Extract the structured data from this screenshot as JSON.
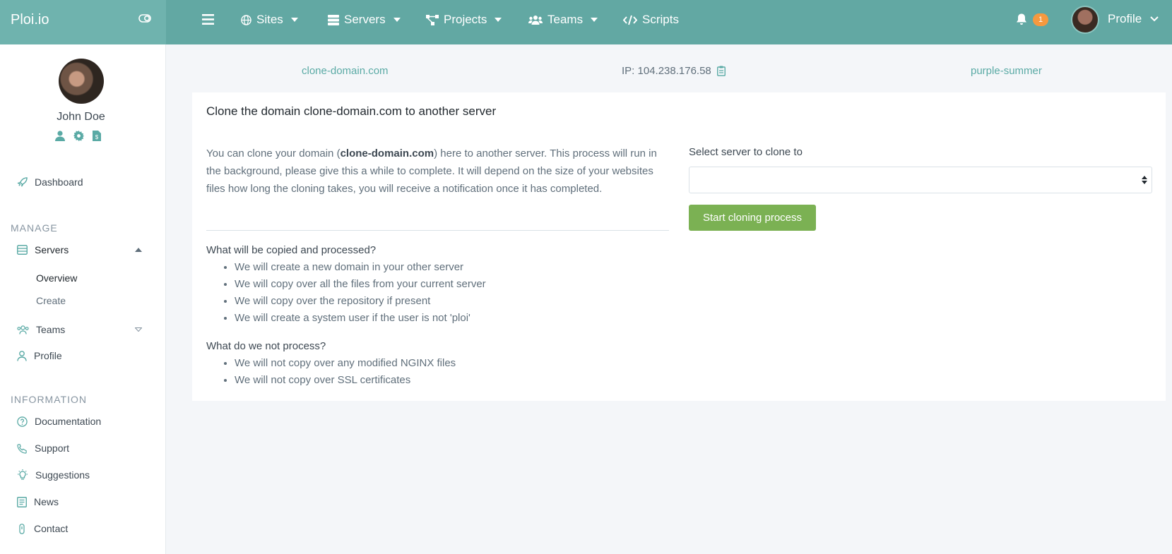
{
  "brand": {
    "name": "Ploi.io"
  },
  "nav": {
    "items": [
      {
        "label": "Sites"
      },
      {
        "label": "Servers"
      },
      {
        "label": "Projects"
      },
      {
        "label": "Teams"
      },
      {
        "label": "Scripts"
      }
    ],
    "notifications_count": "1",
    "profile_label": "Profile"
  },
  "user": {
    "name": "John Doe"
  },
  "sidebar": {
    "dashboard": "Dashboard",
    "manage_heading": "MANAGE",
    "servers": "Servers",
    "servers_sub": [
      "Overview",
      "Create"
    ],
    "teams": "Teams",
    "profile": "Profile",
    "information_heading": "INFORMATION",
    "info_links": [
      "Documentation",
      "Support",
      "Suggestions",
      "News",
      "Contact"
    ]
  },
  "info_bar": {
    "domain": "clone-domain.com",
    "ip": "IP: 104.238.176.58",
    "server": "purple-summer"
  },
  "card": {
    "title": "Clone the domain clone-domain.com to another server",
    "desc_before": "You can clone your domain (",
    "desc_domain": "clone-domain.com",
    "desc_after": ") here to another server. This process will run in the background, please give this a while to complete. It will depend on the size of your websites files how long the cloning takes, you will receive a notification once it has completed.",
    "copied_title": "What will be copied and processed?",
    "copied_items": [
      "We will create a new domain in your other server",
      "We will copy over all the files from your current server",
      "We will copy over the repository if present",
      "We will create a system user if the user is not 'ploi'"
    ],
    "not_title": "What do we not process?",
    "not_items": [
      "We will not copy over any modified NGINX files",
      "We will not copy over SSL certificates"
    ],
    "select_label": "Select server to clone to",
    "select_value": "",
    "button": "Start cloning process"
  },
  "colors": {
    "topbar": "#62a8a3",
    "brand_bg": "#6fb3ae",
    "accent_link": "#5aaaa5",
    "button": "#7bb153",
    "badge": "#f6993f"
  }
}
